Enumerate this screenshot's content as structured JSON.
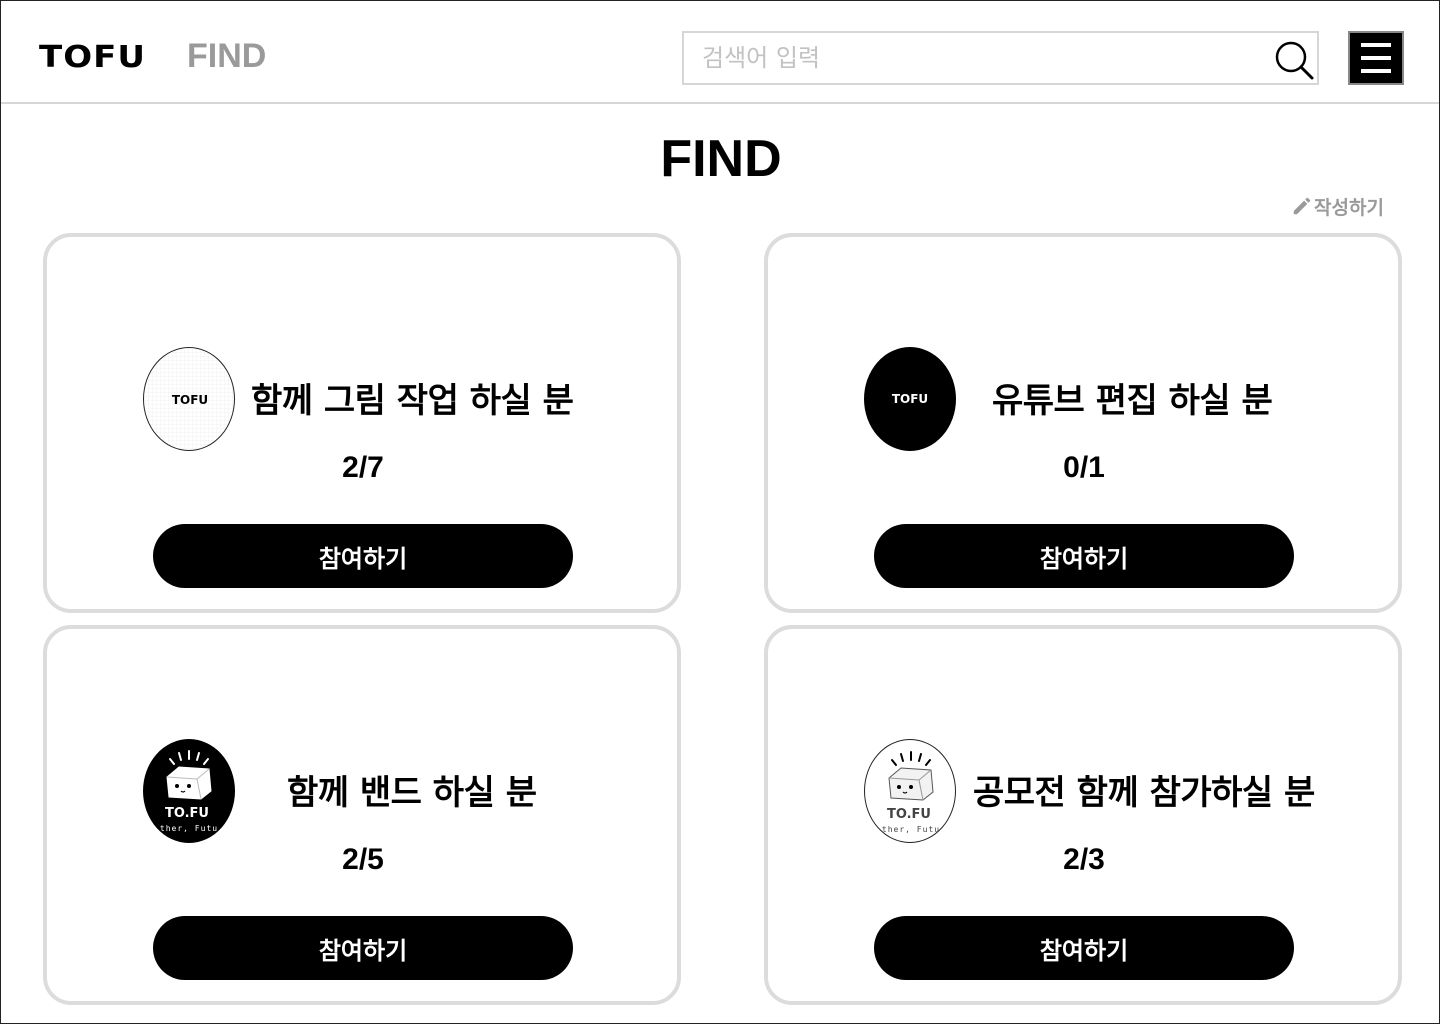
{
  "header": {
    "logo_text": "TOFU",
    "nav_find_label": "FIND",
    "search_placeholder": "검색어 입력"
  },
  "page": {
    "title": "FIND",
    "write_label": "작성하기"
  },
  "cards": [
    {
      "title": "함께 그림 작업 하실 분",
      "count": "2/7",
      "button_label": "참여하기",
      "avatar": {
        "type": "grid-logo",
        "text": "TOFU",
        "bg": "#ffffff",
        "fg": "#000000"
      }
    },
    {
      "title": "유튜브 편집 하실 분",
      "count": "0/1",
      "button_label": "참여하기",
      "avatar": {
        "type": "solid-logo",
        "text": "TOFU",
        "bg": "#000000",
        "fg": "#ffffff"
      }
    },
    {
      "title": "함께 밴드 하실 분",
      "count": "2/5",
      "button_label": "참여하기",
      "avatar": {
        "type": "mascot-logo",
        "text": "TO.FU",
        "subtext": "ther, Futu",
        "bg": "#000000",
        "fg": "#ffffff"
      }
    },
    {
      "title": "공모전 함께 참가하실 분",
      "count": "2/3",
      "button_label": "참여하기",
      "avatar": {
        "type": "mascot-logo",
        "text": "TO.FU",
        "subtext": "ther, Futu",
        "bg": "#ffffff",
        "fg": "#000000"
      }
    }
  ],
  "colors": {
    "accent": "#000000",
    "muted_text": "#9a9a9a",
    "border": "#dcdcdc"
  }
}
